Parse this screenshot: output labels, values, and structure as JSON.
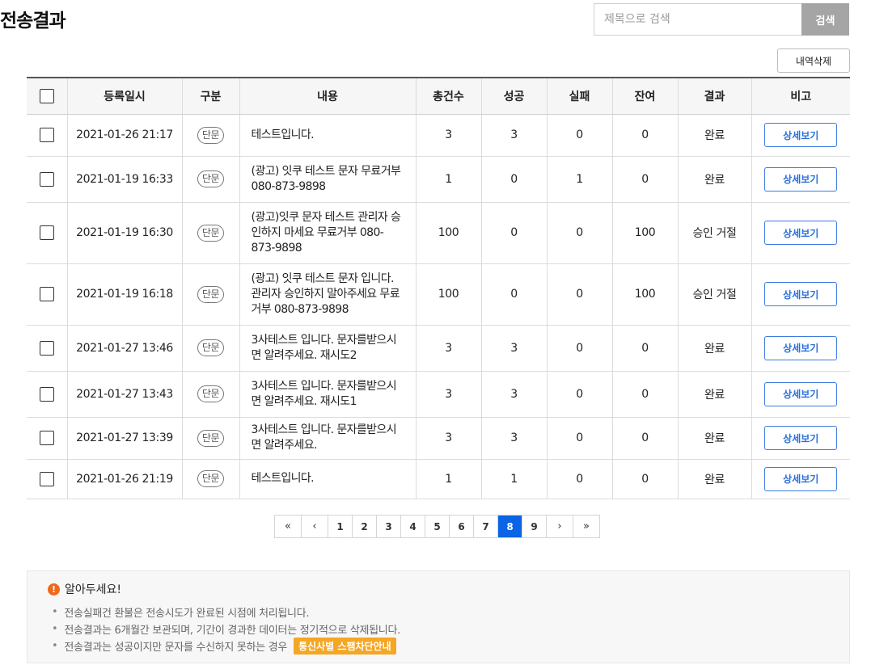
{
  "page_title": "전송결과",
  "search": {
    "placeholder": "제목으로 검색",
    "button_label": "검색"
  },
  "delete_button_label": "내역삭제",
  "table": {
    "headers": [
      "등록일시",
      "구분",
      "내용",
      "총건수",
      "성공",
      "실패",
      "잔여",
      "결과",
      "비고"
    ],
    "rows": [
      {
        "date": "2021-01-26 21:17",
        "type": "단문",
        "content": "테스트입니다.",
        "total": "3",
        "success": "3",
        "fail": "0",
        "remain": "0",
        "result": "완료",
        "action": "상세보기"
      },
      {
        "date": "2021-01-19 16:33",
        "type": "단문",
        "content": "(광고) 잇쿠 테스트 문자 무료거부 080-873-9898",
        "total": "1",
        "success": "0",
        "fail": "1",
        "remain": "0",
        "result": "완료",
        "action": "상세보기"
      },
      {
        "date": "2021-01-19 16:30",
        "type": "단문",
        "content": "(광고)잇쿠 문자 테스트 관리자 승인하지 마세요 무료거부 080-873-9898",
        "total": "100",
        "success": "0",
        "fail": "0",
        "remain": "100",
        "result": "승인 거절",
        "action": "상세보기"
      },
      {
        "date": "2021-01-19 16:18",
        "type": "단문",
        "content": "(광고) 잇쿠 테스트 문자 입니다. 관리자 승인하지 말아주세요 무료거부 080-873-9898",
        "total": "100",
        "success": "0",
        "fail": "0",
        "remain": "100",
        "result": "승인 거절",
        "action": "상세보기"
      },
      {
        "date": "2021-01-27 13:46",
        "type": "단문",
        "content": "3사테스트 입니다. 문자를받으시면 알려주세요. 재시도2",
        "total": "3",
        "success": "3",
        "fail": "0",
        "remain": "0",
        "result": "완료",
        "action": "상세보기"
      },
      {
        "date": "2021-01-27 13:43",
        "type": "단문",
        "content": "3사테스트 입니다. 문자를받으시면 알려주세요. 재시도1",
        "total": "3",
        "success": "3",
        "fail": "0",
        "remain": "0",
        "result": "완료",
        "action": "상세보기"
      },
      {
        "date": "2021-01-27 13:39",
        "type": "단문",
        "content": "3사테스트 입니다. 문자를받으시면 알려주세요.",
        "total": "3",
        "success": "3",
        "fail": "0",
        "remain": "0",
        "result": "완료",
        "action": "상세보기"
      },
      {
        "date": "2021-01-26 21:19",
        "type": "단문",
        "content": "테스트입니다.",
        "total": "1",
        "success": "1",
        "fail": "0",
        "remain": "0",
        "result": "완료",
        "action": "상세보기"
      }
    ]
  },
  "pagination": {
    "first_icon": "double-chevron-left-icon",
    "prev_icon": "chevron-left-icon",
    "next_icon": "chevron-right-icon",
    "last_icon": "double-chevron-right-icon",
    "pages": [
      "1",
      "2",
      "3",
      "4",
      "5",
      "6",
      "7",
      "8",
      "9"
    ],
    "current": "8"
  },
  "notice": {
    "icon": "warning-icon",
    "title": "알아두세요!",
    "items": [
      "전송실패건 환불은 전송시도가 완료된 시점에 처리됩니다.",
      "전송결과는 6개월간 보관되며, 기간이 경과한 데이터는 정기적으로 삭제됩니다.",
      "전송결과는 성공이지만 문자를 수신하지 못하는 경우"
    ],
    "link_label": "통신사별 스팸차단안내"
  },
  "colors": {
    "primary": "#0b63e5",
    "detail_button": "#3d7be0",
    "notice_accent": "#f5a623",
    "warning_icon": "#ee6a1b",
    "search_button": "#a5a5a5"
  }
}
